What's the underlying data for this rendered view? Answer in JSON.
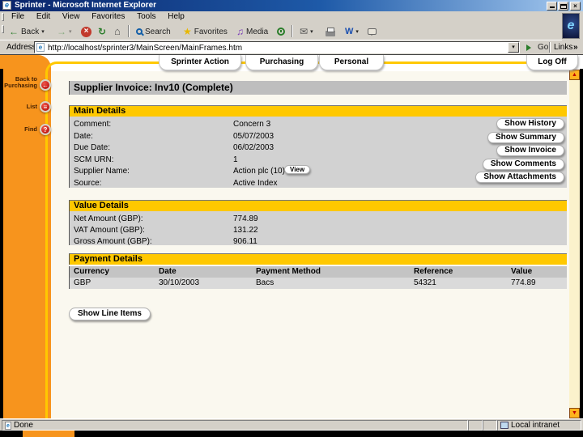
{
  "window": {
    "title": "Sprinter - Microsoft Internet Explorer"
  },
  "menu": {
    "items": [
      "File",
      "Edit",
      "View",
      "Favorites",
      "Tools",
      "Help"
    ]
  },
  "toolbar": {
    "back_label": "Back",
    "search_label": "Search",
    "favorites_label": "Favorites",
    "media_label": "Media"
  },
  "address": {
    "label": "Address",
    "url": "http://localhost/sprinter3/MainScreen/MainFrames.htm",
    "go_label": "Go",
    "links_label": "Links"
  },
  "nav": {
    "tabs": [
      "Sprinter Action",
      "Purchasing",
      "Personal"
    ],
    "logoff_label": "Log Off"
  },
  "sidebar": {
    "items": [
      "Back to Purchasing",
      "List",
      "Find"
    ]
  },
  "content": {
    "page_title": "Supplier Invoice: Inv10 (Complete)",
    "main_details": {
      "heading": "Main Details",
      "fields": [
        {
          "label": "Comment:",
          "value": "Concern 3"
        },
        {
          "label": "Date:",
          "value": "05/07/2003"
        },
        {
          "label": "Due Date:",
          "value": "06/02/2003"
        },
        {
          "label": "SCM URN:",
          "value": "1"
        },
        {
          "label": "Supplier Name:",
          "value": "Action plc (10)"
        },
        {
          "label": "Source:",
          "value": "Active Index"
        }
      ],
      "view_button": "View",
      "action_buttons": [
        "Show History",
        "Show Summary",
        "Show Invoice",
        "Show Comments",
        "Show Attachments"
      ]
    },
    "value_details": {
      "heading": "Value Details",
      "fields": [
        {
          "label": "Net Amount (GBP):",
          "value": "774.89"
        },
        {
          "label": "VAT Amount (GBP):",
          "value": "131.22"
        },
        {
          "label": "Gross Amount (GBP):",
          "value": "906.11"
        }
      ]
    },
    "payment_details": {
      "heading": "Payment Details",
      "columns": [
        "Currency",
        "Date",
        "Payment Method",
        "Reference",
        "Value"
      ],
      "rows": [
        [
          "GBP",
          "30/10/2003",
          "Bacs",
          "54321",
          "774.89"
        ]
      ]
    },
    "show_line_items_label": "Show Line Items"
  },
  "statusbar": {
    "status": "Done",
    "zone": "Local intranet"
  },
  "icons": {
    "ie_logo": "e",
    "back": "←",
    "forward": "→",
    "stop": "×",
    "refresh": "↻",
    "home": "⌂",
    "favorites_star": "★",
    "media_note": "♫",
    "mail": "✉",
    "dropdown": "▾",
    "close": "×",
    "links_chevron": "»",
    "scroll_up": "▲",
    "scroll_down": "▼",
    "sidebar_back": "←",
    "sidebar_list": "≡",
    "sidebar_find": "?"
  },
  "colors": {
    "sidebar_orange": "#F7941D",
    "accent_gold": "#FFC800",
    "icon_red": "#C00000",
    "titlebar_blue": "#0A246A",
    "panel_gray": "#D2D2D2"
  }
}
